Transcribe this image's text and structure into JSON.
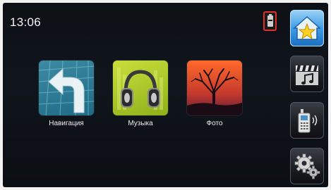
{
  "status": {
    "time": "13:06",
    "status_icon": "battery-icon"
  },
  "apps": [
    {
      "label": "Навигация",
      "icon": "navigation-icon"
    },
    {
      "label": "Музыка",
      "icon": "headphones-icon"
    },
    {
      "label": "Фото",
      "icon": "photo-tree-icon"
    }
  ],
  "sidebar": {
    "items": [
      {
        "icon": "home-star-icon",
        "active": true
      },
      {
        "icon": "media-icon",
        "active": false
      },
      {
        "icon": "phone-icon",
        "active": false
      },
      {
        "icon": "settings-gears-icon",
        "active": false
      }
    ]
  },
  "colors": {
    "screen_bg": "#0d1116",
    "highlight": "#e0302a",
    "active_button": "#3f9de6"
  }
}
